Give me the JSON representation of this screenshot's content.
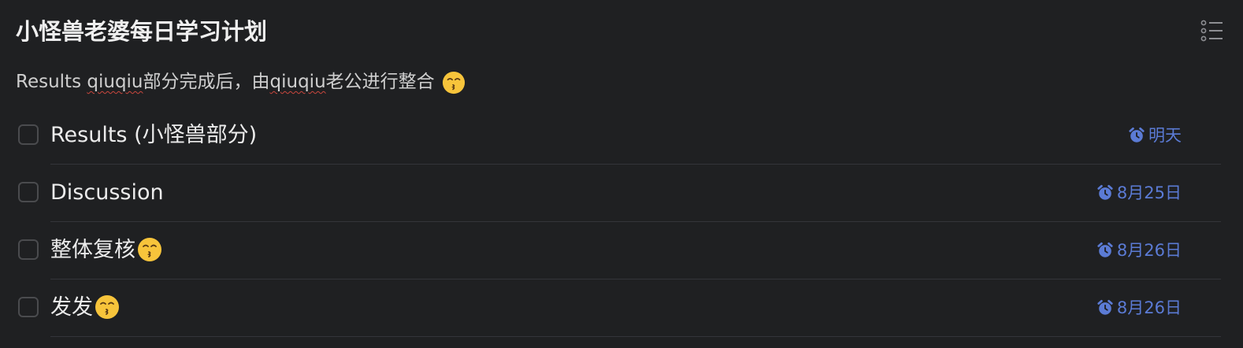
{
  "list": {
    "title": "小怪兽老婆每日学习计划",
    "description": {
      "prefix": "Results ",
      "word1": "qiuqiu",
      "middle": "部分完成后，由",
      "word2": "qiuqiu",
      "suffix": "老公进行整合",
      "emoji": "kissing-face-emoji"
    },
    "options_icon": "list-options-icon"
  },
  "tasks": [
    {
      "title": "Results (小怪兽部分)",
      "due": "明天",
      "emoji": null
    },
    {
      "title": "Discussion",
      "due": "8月25日",
      "emoji": null
    },
    {
      "title": "整体复核",
      "due": "8月26日",
      "emoji": "kissing-face-emoji"
    },
    {
      "title": "发发",
      "due": "8月26日",
      "emoji": "kissing-face-emoji"
    }
  ],
  "colors": {
    "background": "#1f2022",
    "due_accent": "#5b7bd5",
    "divider": "#34353a"
  }
}
